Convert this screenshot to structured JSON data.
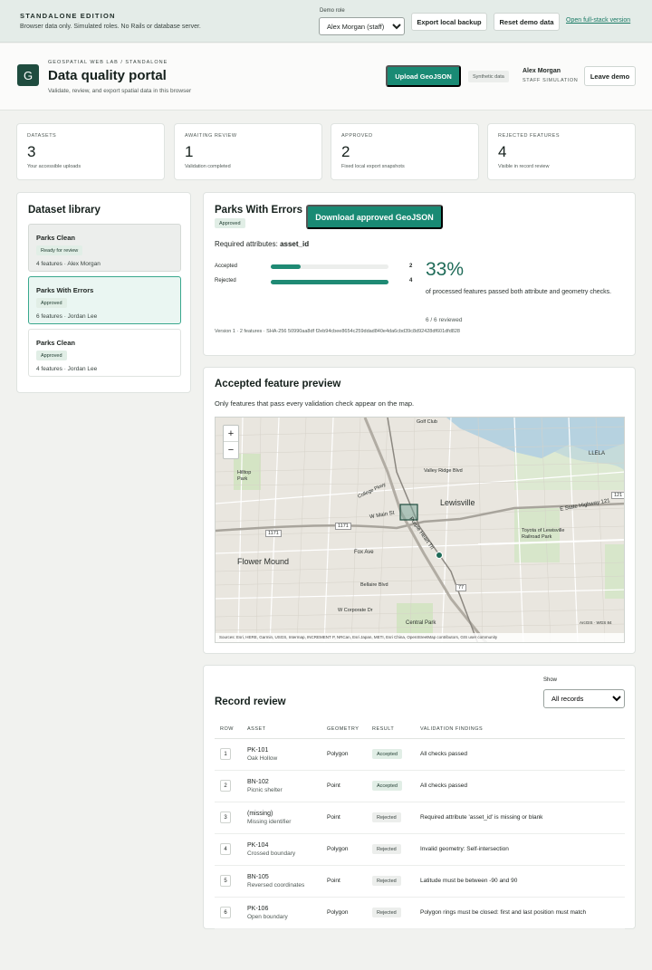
{
  "banner": {
    "edition": "STANDALONE EDITION",
    "description": "Browser data only. Simulated roles. No Rails or database server.",
    "role_label": "Demo role",
    "role_value": "Alex Morgan (staff)",
    "export_label": "Export local backup",
    "reset_label": "Reset demo data",
    "fullstack_link": "Open full-stack version"
  },
  "header": {
    "logo_letter": "G",
    "eyebrow": "GEOSPATIAL WEB LAB / STANDALONE",
    "title": "Data quality portal",
    "subtitle": "Validate, review, and export spatial data in this browser",
    "upload_label": "Upload GeoJSON",
    "synthetic_badge": "Synthetic data",
    "user_name": "Alex Morgan",
    "user_role": "STAFF SIMULATION",
    "leave_label": "Leave demo"
  },
  "stats": [
    {
      "label": "DATASETS",
      "value": "3",
      "caption": "Your accessible uploads"
    },
    {
      "label": "AWAITING REVIEW",
      "value": "1",
      "caption": "Validation completed"
    },
    {
      "label": "APPROVED",
      "value": "2",
      "caption": "Fixed local export snapshots"
    },
    {
      "label": "REJECTED FEATURES",
      "value": "4",
      "caption": "Visible in record review"
    }
  ],
  "library": {
    "title": "Dataset library",
    "items": [
      {
        "name": "Parks Clean",
        "badge": "Ready for review",
        "meta": "4 features · Alex Morgan"
      },
      {
        "name": "Parks With Errors",
        "badge": "Approved",
        "meta": "6 features · Jordan Lee"
      },
      {
        "name": "Parks Clean",
        "badge": "Approved",
        "meta": "4 features · Jordan Lee"
      }
    ]
  },
  "detail": {
    "title": "Parks With Errors",
    "badge": "Approved",
    "download_label": "Download approved GeoJSON",
    "required_prefix": "Required attributes:",
    "required_attr": "asset_id",
    "accepted_label": "Accepted",
    "accepted_count": 2,
    "rejected_label": "Rejected",
    "rejected_count": 4,
    "total": 6,
    "percent": "33%",
    "percent_caption": "of processed features passed both attribute and geometry checks.",
    "reviewed": "6 / 6 reviewed",
    "version": "Version 1 · 2 features · SHA-256 50990aa8df f2eb94cbee8654c259ddad840e4da6cbd39c8d92428df601dfd828"
  },
  "preview": {
    "title": "Accepted feature preview",
    "subtitle": "Only features that pass every validation check appear on the map.",
    "zoom_in": "+",
    "zoom_out": "−",
    "labels": {
      "lewisville": "Lewisville",
      "flower_mound": "Flower Mound",
      "central_park": "Central Park",
      "golf_club": "Golf Club",
      "llela": "LLELA",
      "toyota": "Toyota of Lewisville Railroad Park",
      "hilltop": "Hilltop Park",
      "main_st": "W Main St",
      "e_state_hwy": "E State Highway 121",
      "purple_heart": "Purple Heart Trl",
      "fox_ave": "Fox Ave",
      "college_pkwy": "College Pkwy",
      "valley_ridge": "Valley Ridge Blvd",
      "bellaire": "Bellaire Blvd",
      "corporate": "W Corporate Dr",
      "hwy_1171": "1171",
      "hwy_121": "121",
      "hwy_77": "77",
      "esri": "ArcGIS · WGS 84"
    },
    "attribution": "Sources: Esri, HERE, Garmin, USGS, Intermap, INCREMENT P, NRCan, Esri Japan, METI, Esri China, OpenStreetMap contributors, GIS user community"
  },
  "review": {
    "title": "Record review",
    "show_label": "Show",
    "filter_value": "All records",
    "columns": [
      "ROW",
      "ASSET",
      "GEOMETRY",
      "RESULT",
      "VALIDATION FINDINGS"
    ],
    "rows": [
      {
        "row": "1",
        "id": "PK-101",
        "name": "Oak Hollow",
        "geometry": "Polygon",
        "result": "Accepted",
        "finding": "All checks passed"
      },
      {
        "row": "2",
        "id": "BN-102",
        "name": "Picnic shelter",
        "geometry": "Point",
        "result": "Accepted",
        "finding": "All checks passed"
      },
      {
        "row": "3",
        "id": "(missing)",
        "name": "Missing identifier",
        "geometry": "Point",
        "result": "Rejected",
        "finding": "Required attribute 'asset_id' is missing or blank"
      },
      {
        "row": "4",
        "id": "PK-104",
        "name": "Crossed boundary",
        "geometry": "Polygon",
        "result": "Rejected",
        "finding": "Invalid geometry: Self-intersection"
      },
      {
        "row": "5",
        "id": "BN-105",
        "name": "Reversed coordinates",
        "geometry": "Point",
        "result": "Rejected",
        "finding": "Latitude must be between -90 and 90"
      },
      {
        "row": "6",
        "id": "PK-106",
        "name": "Open boundary",
        "geometry": "Polygon",
        "result": "Rejected",
        "finding": "Polygon rings must be closed: first and last position must match"
      }
    ]
  }
}
